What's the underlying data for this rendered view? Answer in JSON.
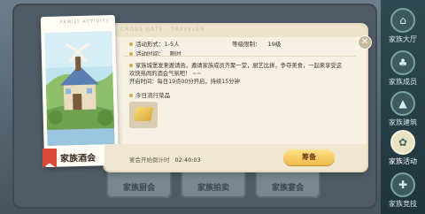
{
  "background_cards": [
    "家族厨会",
    "家族拍卖",
    "家族宴会"
  ],
  "nav": [
    {
      "label": "家族大厅",
      "icon": "house-icon",
      "glyph": "⌂"
    },
    {
      "label": "家族成员",
      "icon": "members-icon",
      "glyph": "♣"
    },
    {
      "label": "家族建筑",
      "icon": "building-icon",
      "glyph": "▲"
    },
    {
      "label": "家族活动",
      "icon": "activity-icon",
      "glyph": "✿"
    },
    {
      "label": "家族竞技",
      "icon": "shield-icon",
      "glyph": "✚"
    }
  ],
  "popup": {
    "header_watermark": "CROSS GATE · TRAVELER",
    "close_glyph": "✕",
    "image_card": {
      "tag": "FAMILY ACTIVITY",
      "label": "家族酒会"
    },
    "activity_form_label": "活动形式：",
    "activity_form_value": "1-5人",
    "level_limit_label": "等级限制：",
    "level_limit_value": "19级",
    "activity_time_label": "活动时间：",
    "activity_time_value": "限时",
    "description": "家族城堡发来邀请函，邀请家族成员齐聚一堂，厨艺比拼，争夺美食，一起来享受这欢快热闹的酒会气氛吧！ ~~",
    "open_time": "开启时间：每日19点00分开启，持续15分钟",
    "today_menu_label": "今日流行菜品",
    "countdown_label": "宴会开始倒计时",
    "countdown_value": "02:40:03",
    "action_button": "筹备"
  }
}
